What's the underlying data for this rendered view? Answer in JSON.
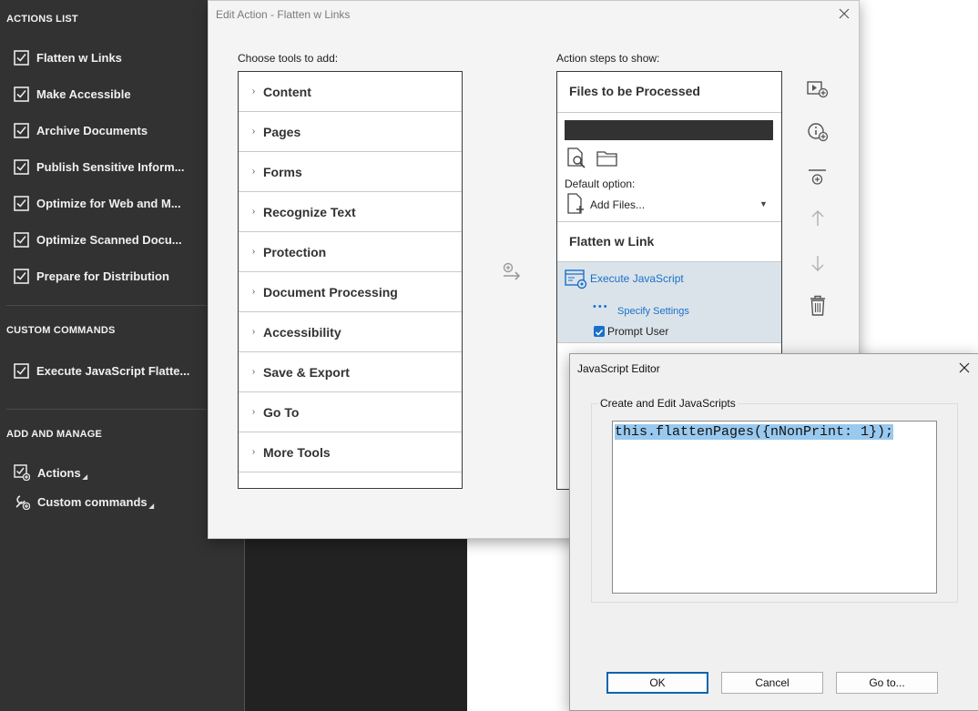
{
  "sidebar": {
    "sections": {
      "actions_list": "ACTIONS LIST",
      "custom_commands": "CUSTOM COMMANDS",
      "add_and_manage": "ADD AND MANAGE"
    },
    "actions": [
      "Flatten w Links",
      "Make Accessible",
      "Archive Documents",
      "Publish Sensitive Inform...",
      "Optimize for Web and M...",
      "Optimize Scanned Docu...",
      "Prepare for Distribution"
    ],
    "custom_commands": [
      "Execute JavaScript Flatte..."
    ],
    "manage": {
      "actions": "Actions",
      "custom_commands": "Custom commands"
    }
  },
  "edit_action": {
    "title": "Edit Action - Flatten w Links",
    "choose_label": "Choose tools to add:",
    "steps_label": "Action steps to show:",
    "tools": [
      "Content",
      "Pages",
      "Forms",
      "Recognize Text",
      "Protection",
      "Document Processing",
      "Accessibility",
      "Save & Export",
      "Go To",
      "More Tools"
    ],
    "steps": {
      "files_header": "Files to be Processed",
      "default_option_label": "Default option:",
      "add_files": "Add Files...",
      "group_header": "Flatten w Link",
      "step_name": "Execute JavaScript",
      "specify_settings": "Specify Settings",
      "prompt_user": "Prompt User",
      "prompt_user_checked": true
    }
  },
  "js_editor": {
    "title": "JavaScript Editor",
    "group_label": "Create and Edit JavaScripts",
    "code": "this.flattenPages({nNonPrint: 1});",
    "buttons": {
      "ok": "OK",
      "cancel": "Cancel",
      "goto": "Go to..."
    }
  },
  "colors": {
    "sidebar_bg": "#323232",
    "accent": "#1a6fc9",
    "selection": "#dbe3ea",
    "code_highlight": "#99c9ef"
  }
}
